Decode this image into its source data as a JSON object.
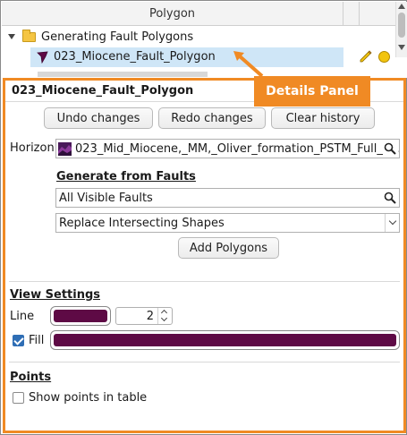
{
  "list": {
    "column_header": "Polygon",
    "group_label": "Generating Fault Polygons",
    "selected_item": "023_Miocene_Fault_Polygon"
  },
  "panel": {
    "title": "023_Miocene_Fault_Polygon",
    "undo_label": "Undo changes",
    "redo_label": "Redo changes",
    "clear_label": "Clear history",
    "horizon_label": "Horizon",
    "horizon_value": "023_Mid_Miocene,_MM,_Oliver_formation_PSTM_Full_p...",
    "generate_title": "Generate from Faults",
    "faults_value": "All Visible Faults",
    "mode_value": "Replace Intersecting Shapes",
    "add_polygons_label": "Add Polygons",
    "view_title": "View Settings",
    "line_label": "Line",
    "line_width": "2",
    "fill_label": "Fill",
    "fill_checked": true,
    "points_title": "Points",
    "show_points_label": "Show points in table",
    "show_points_checked": false
  },
  "callout": {
    "text": "Details Panel"
  },
  "colors": {
    "accent": "#f08a24",
    "line_color": "#5e0a45",
    "fill_color": "#5e0a45",
    "selection": "#cfe6f7"
  }
}
